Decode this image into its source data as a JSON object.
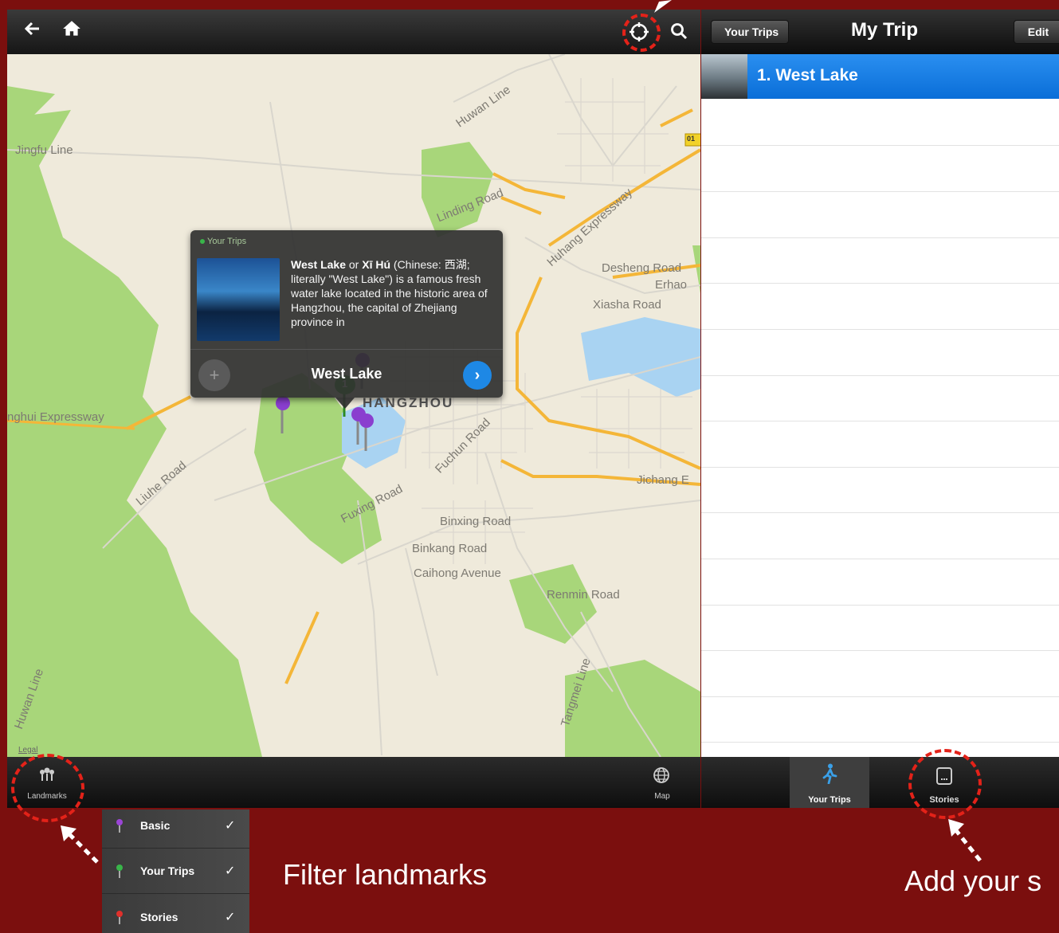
{
  "map": {
    "legal": "Legal",
    "landmarks_label": "Landmarks",
    "map_label": "Map",
    "road_labels": [
      "Jingfu Line",
      "Huwan Line",
      "Linding Road",
      "Huhang Expressway",
      "Desheng Road",
      "Erhao",
      "Xiasha Road",
      "Jichang E",
      "Binxing Road",
      "Binkang Road",
      "Caihong Avenue",
      "Renmin Road",
      "Fuxing Road",
      "Fuchun Road",
      "Liuhe Road",
      "nghui Expressway",
      "Tangmei Line",
      "Huwan Line"
    ],
    "city_label": "HANGZHOU",
    "highway_badge": "01",
    "active_pin_number": "1"
  },
  "popup": {
    "tag": "Your Trips",
    "text_bold": "West Lake",
    "text_or": " or ",
    "text_bold2": "Xī Hú",
    "text_rest": " (Chinese: 西湖; literally \"West Lake\") is a famous fresh water lake located in the historic area of Hangzhou, the capital of Zhejiang province in",
    "title": "West Lake"
  },
  "trip": {
    "back_label": "Your Trips",
    "title": "My Trip",
    "edit_label": "Edit",
    "items": [
      {
        "label": "1. West Lake"
      }
    ],
    "tabs": [
      {
        "label": "Your Trips"
      },
      {
        "label": "Stories"
      }
    ]
  },
  "filters": [
    {
      "label": "Basic",
      "color": "#9b45d6",
      "checked": "✓"
    },
    {
      "label": "Your Trips",
      "color": "#39b54a",
      "checked": "✓"
    },
    {
      "label": "Stories",
      "color": "#e0302b",
      "checked": "✓"
    }
  ],
  "captions": {
    "filter": "Filter landmarks",
    "stories": "Add your s"
  },
  "colors": {
    "background": "#7b0f0e",
    "annotation": "#e32219",
    "selected_row": "#1a7fe6"
  }
}
